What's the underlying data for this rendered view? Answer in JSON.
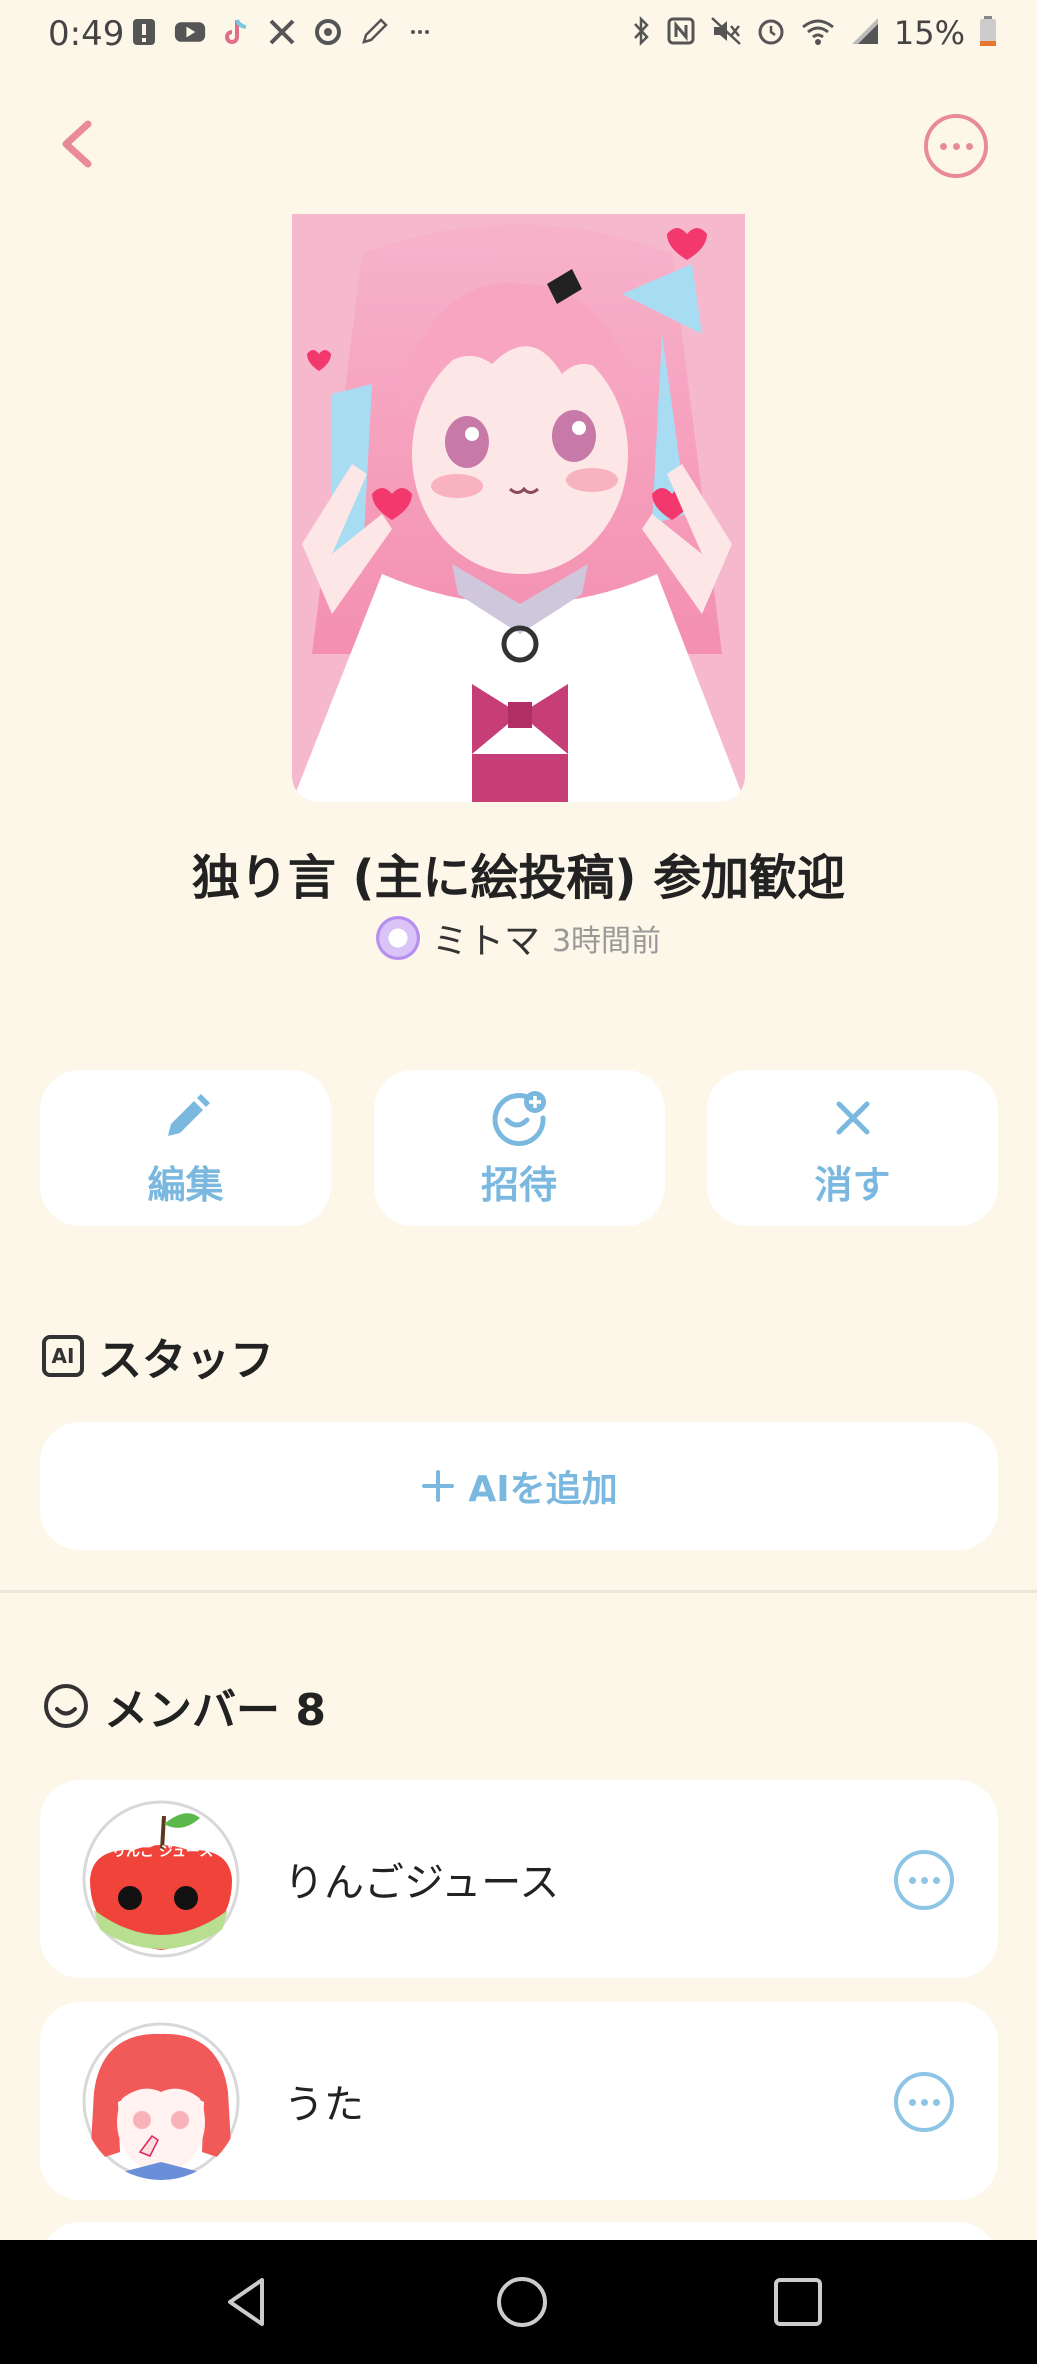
{
  "status_bar": {
    "time": "0:49",
    "battery": "15%",
    "icons": [
      "alert-icon",
      "youtube-icon",
      "tiktok-icon",
      "x-icon",
      "threads-icon",
      "pencil-icon",
      "more-icon",
      "bluetooth-icon",
      "nfc-icon",
      "mute-icon",
      "alarm-icon",
      "wifi-icon",
      "signal-icon",
      "battery-icon"
    ]
  },
  "header": {
    "back_icon": "chevron-left-icon",
    "more_icon": "more-horizontal-icon"
  },
  "room": {
    "title": "独り言 (主に絵投稿) 参加歓迎",
    "author": "ミトマ",
    "time_ago": "3時間前"
  },
  "actions": [
    {
      "label": "編集",
      "icon": "pencil-icon"
    },
    {
      "label": "招待",
      "icon": "invite-icon"
    },
    {
      "label": "消す",
      "icon": "close-icon"
    }
  ],
  "staff": {
    "badge": "AI",
    "title": "スタッフ",
    "add_label": "AIを追加"
  },
  "members": {
    "title": "メンバー 8",
    "items": [
      {
        "name": "りんごジュース",
        "avatar_text": "りんご ジュース"
      },
      {
        "name": "うた"
      }
    ]
  },
  "colors": {
    "background": "#fdf7ea",
    "accent_pink": "#e88a97",
    "accent_blue": "#7ab8e0"
  }
}
